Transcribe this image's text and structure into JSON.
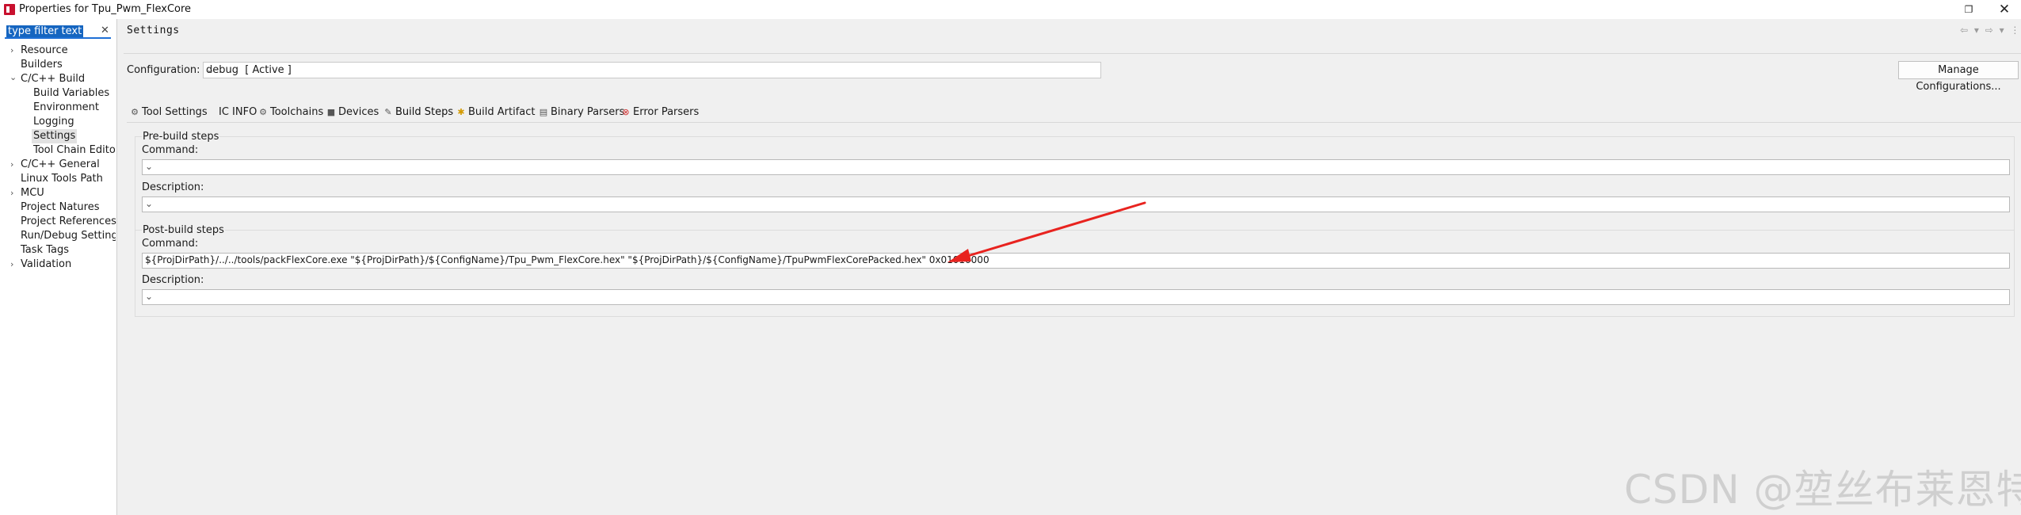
{
  "window": {
    "title": "Properties for Tpu_Pwm_FlexCore",
    "restore_glyph": "❐",
    "close_glyph": "✕"
  },
  "filter": {
    "text": "type filter text",
    "clear_glyph": "✕"
  },
  "tree": {
    "items": [
      {
        "label": "Resource",
        "expander": "›"
      },
      {
        "label": "Builders",
        "expander": ""
      },
      {
        "label": "C/C++ Build",
        "expander": "⌄"
      },
      {
        "label": "Build Variables",
        "expander": ""
      },
      {
        "label": "Environment",
        "expander": ""
      },
      {
        "label": "Logging",
        "expander": ""
      },
      {
        "label": "Settings",
        "expander": "",
        "selected": true
      },
      {
        "label": "Tool Chain Editor",
        "expander": ""
      },
      {
        "label": "C/C++ General",
        "expander": "›"
      },
      {
        "label": "Linux Tools Path",
        "expander": ""
      },
      {
        "label": "MCU",
        "expander": "›"
      },
      {
        "label": "Project Natures",
        "expander": ""
      },
      {
        "label": "Project References",
        "expander": ""
      },
      {
        "label": "Run/Debug Settings",
        "expander": ""
      },
      {
        "label": "Task Tags",
        "expander": ""
      },
      {
        "label": "Validation",
        "expander": "›"
      }
    ]
  },
  "settings": {
    "title": "Settings",
    "nav_icons": "⇦ ▾ ⇨ ▾ ⋮"
  },
  "configuration": {
    "label": "Configuration:",
    "value": "debug  [ Active ]",
    "manage_label": "Manage Configurations..."
  },
  "tabs": [
    {
      "label": "Tool Settings",
      "icon": "⚙"
    },
    {
      "label": "IC INFO",
      "icon": ""
    },
    {
      "label": "Toolchains",
      "icon": "⚙"
    },
    {
      "label": "Devices",
      "icon": "■"
    },
    {
      "label": "Build Steps",
      "icon": "✎",
      "active": true
    },
    {
      "label": "Build Artifact",
      "icon": "✱"
    },
    {
      "label": "Binary Parsers",
      "icon": "▤"
    },
    {
      "label": "Error Parsers",
      "icon": "⊗"
    }
  ],
  "pre_build": {
    "title": "Pre-build steps",
    "command_label": "Command:",
    "command_value": "",
    "description_label": "Description:",
    "description_value": ""
  },
  "post_build": {
    "title": "Post-build steps",
    "command_label": "Command:",
    "command_value": "${ProjDirPath}/../../tools/packFlexCore.exe \"${ProjDirPath}/${ConfigName}/Tpu_Pwm_FlexCore.hex\" \"${ProjDirPath}/${ConfigName}/TpuPwmFlexCorePacked.hex\" 0x01010000",
    "description_label": "Description:",
    "description_value": ""
  },
  "dropdown_glyph": "⌄",
  "watermark": "CSDN @堃丝布莱恩特",
  "colors": {
    "selection": "#1565c0",
    "annotation_arrow": "#e8231f"
  }
}
